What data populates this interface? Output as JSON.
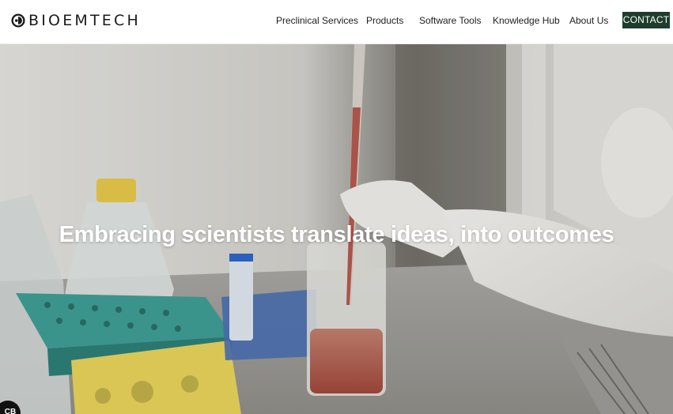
{
  "brand": {
    "name": "BIOEMTECH",
    "accent_color": "#1e3d2c"
  },
  "nav": {
    "items": [
      {
        "label": "Preclinical Services"
      },
      {
        "label": "Products"
      },
      {
        "label": "Software Tools"
      },
      {
        "label": "Knowledge Hub"
      },
      {
        "label": "About Us"
      }
    ],
    "cta_label": "CONTACT"
  },
  "hero": {
    "headline": "Embracing scientists translate ideas, into outcomes",
    "image_subject": "lab-bench-pipette-scene"
  },
  "badge": {
    "label": "CB",
    "icon": "chat-badge-icon"
  }
}
